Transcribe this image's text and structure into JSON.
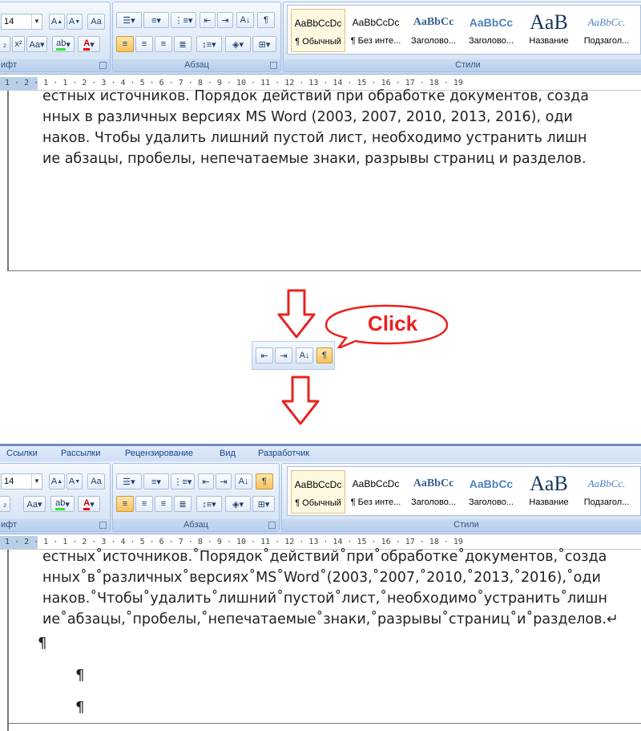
{
  "ribbon_top": {
    "font_size": "14",
    "group_label_font": "ифт",
    "group_label_paragraph": "Абзац",
    "group_label_styles": "Стили"
  },
  "styles": [
    {
      "sample": "AaBbCcDc",
      "name": "¶ Обычный"
    },
    {
      "sample": "AaBbCcDc",
      "name": "¶ Без инте..."
    },
    {
      "sample": "AaBbCc",
      "name": "Заголово..."
    },
    {
      "sample": "AaBbCc",
      "name": "Заголово..."
    },
    {
      "sample": "AaB",
      "name": "Название"
    },
    {
      "sample": "AaBbCc.",
      "name": "Подзагол..."
    }
  ],
  "ruler_numbers": "1 · 2 · 1 · 1 · 2 · 3 · 4 · 5 · 6 · 7 · 8 · 9 · 10 · 11 · 12 · 13 · 14 · 15 · 16 · 17 · 18 · 19",
  "doc_top": {
    "lines": [
      "естных источников. Порядок действий при обработке документов, созда",
      "нных в различных версиях MS Word (2003, 2007, 2010, 2013, 2016), оди",
      "наков. Чтобы удалить лишний пустой лист, необходимо устранить лишн",
      "ие абзацы, пробелы, непечатаемые знаки, разрывы страниц и разделов."
    ]
  },
  "callout": {
    "click_text": "Click",
    "pilcrow": "¶"
  },
  "tabs": [
    "Ссылки",
    "Рассылки",
    "Рецензирование",
    "Вид",
    "Разработчик"
  ],
  "doc_bottom": {
    "lines": [
      "естных˚источников.˚Порядок˚действий˚при˚обработке˚документов,˚созда",
      "нных˚в˚различных˚версиях˚MS˚Word˚(2003,˚2007,˚2010,˚2013,˚2016),˚оди",
      "наков.˚Чтобы˚удалить˚лишний˚пустой˚лист,˚необходимо˚устранить˚лишн",
      "ие˚абзацы,˚пробелы,˚непечатаемые˚знаки,˚разрывы˚страниц˚и˚разделов.↵"
    ],
    "pilcrow": "¶"
  },
  "colors": {
    "accent_red": "#e8231f",
    "ribbon_blue": "#d3e2f5",
    "active_button": "#f9c15b"
  }
}
